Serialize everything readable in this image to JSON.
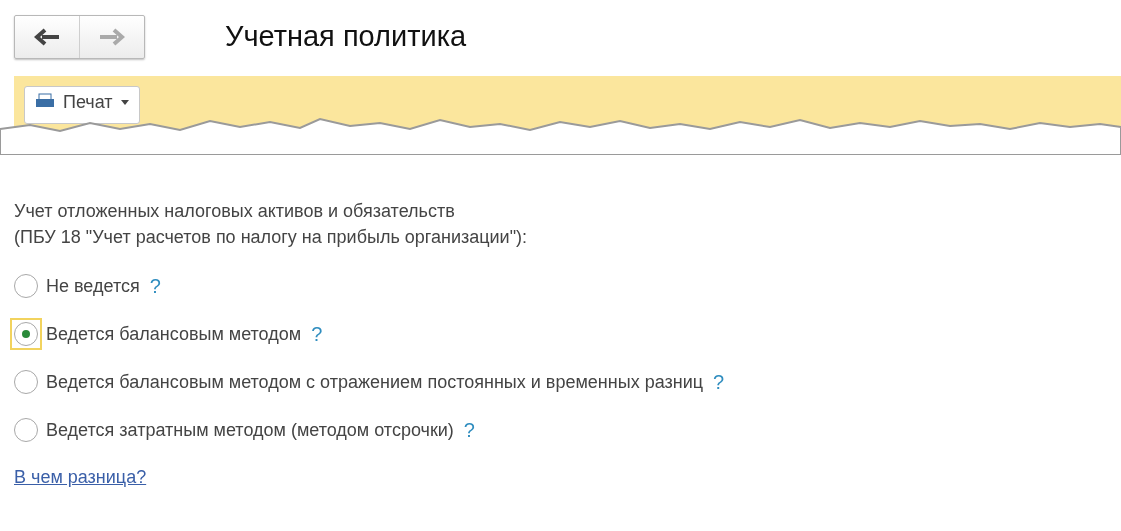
{
  "window": {
    "title": "Учетная политика"
  },
  "toolbar": {
    "print_button": "Печат"
  },
  "section": {
    "heading": "Учет отложенных налоговых активов и обязательств\n(ПБУ 18 \"Учет расчетов по налогу на прибыль организации\"):",
    "options": [
      {
        "label": "Не ведется",
        "help": "?",
        "selected": false
      },
      {
        "label": "Ведется балансовым методом",
        "help": "?",
        "selected": true
      },
      {
        "label": "Ведется балансовым методом с отражением постоянных и временных разниц",
        "help": "?",
        "selected": false
      },
      {
        "label": "Ведется затратным методом (методом отсрочки)",
        "help": "?",
        "selected": false
      }
    ],
    "link": "В чем разница?"
  }
}
